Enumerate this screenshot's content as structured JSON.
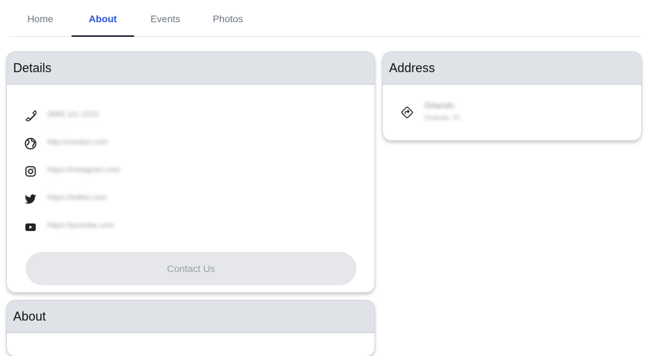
{
  "tabs": [
    {
      "label": "Home",
      "active": false
    },
    {
      "label": "About",
      "active": true
    },
    {
      "label": "Events",
      "active": false
    },
    {
      "label": "Photos",
      "active": false
    }
  ],
  "details": {
    "title": "Details",
    "items": [
      {
        "icon": "phone-icon",
        "value": "(888) 111-2233"
      },
      {
        "icon": "globe-icon",
        "value": "http://contact.com"
      },
      {
        "icon": "instagram-icon",
        "value": "https://instagram.com"
      },
      {
        "icon": "twitter-icon",
        "value": "https://twitter.com"
      },
      {
        "icon": "youtube-icon",
        "value": "https://youtube.com"
      }
    ],
    "contact_button": "Contact Us"
  },
  "address": {
    "title": "Address",
    "icon": "directions-icon",
    "city": "Orlando",
    "region": "Orlando, FL"
  },
  "about": {
    "title": "About"
  },
  "colors": {
    "accent": "#2952d9",
    "header_bg": "#dfe2e6",
    "button_bg": "#e5e7eb"
  }
}
